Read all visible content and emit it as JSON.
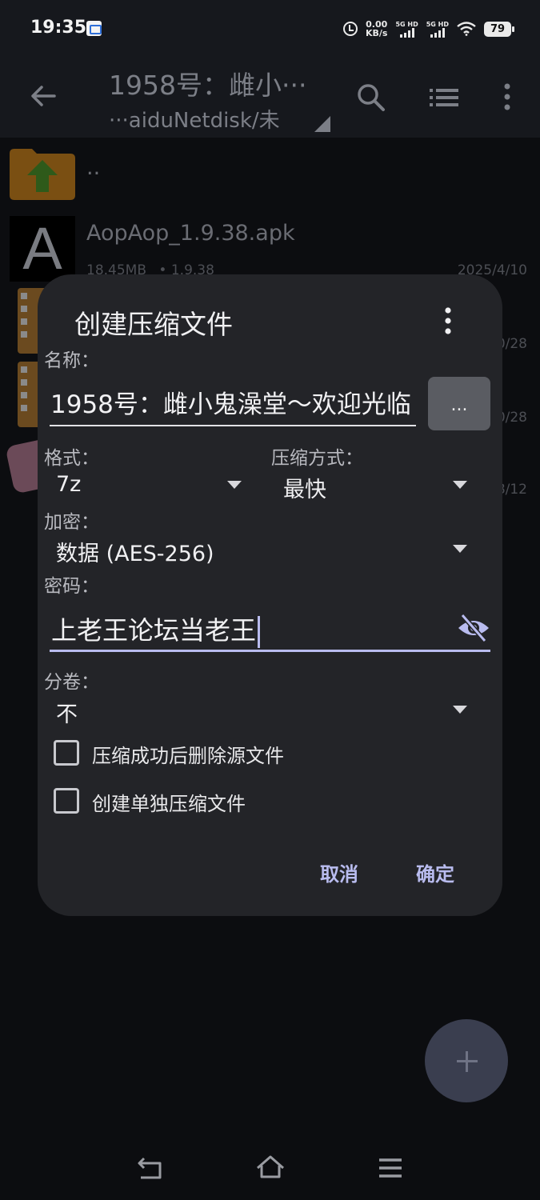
{
  "status_bar": {
    "time": "19:35",
    "speed_value": "0.00",
    "speed_unit": "KB/s",
    "sim1": "5G HD",
    "sim2": "5G HD",
    "battery": "79"
  },
  "app_bar": {
    "title": "1958号：雌小···",
    "subtitle": "···aiduNetdisk/未"
  },
  "file_list": {
    "parent": "..",
    "items": [
      {
        "name": "AopAop_1.9.38.apk",
        "size": "18.45MB",
        "version": "1.9.38",
        "date": "2025/4/10"
      },
      {
        "date": "0/28"
      },
      {
        "date": "0/28"
      },
      {
        "date": "8/12"
      }
    ]
  },
  "dialog": {
    "title": "创建压缩文件",
    "name_label": "名称：",
    "name_value": "1958号：雌小鬼澡堂～欢迎光临",
    "browse_label": "...",
    "format_label": "格式：",
    "format_value": "7z",
    "method_label": "压缩方式：",
    "method_value": "最快",
    "encrypt_label": "加密：",
    "encrypt_value": "数据 (AES-256)",
    "password_label": "密码：",
    "password_value": "上老王论坛当老王",
    "split_label": "分卷：",
    "split_value": "不",
    "checkbox_delete": "压缩成功后删除源文件",
    "checkbox_separate": "创建单独压缩文件",
    "cancel": "取消",
    "ok": "确定"
  },
  "colors": {
    "accent": "#b9bcef",
    "dialog_bg": "#232428",
    "folder_orange": "#7a4f12",
    "folder_arrow_green": "#2e5a1a"
  }
}
